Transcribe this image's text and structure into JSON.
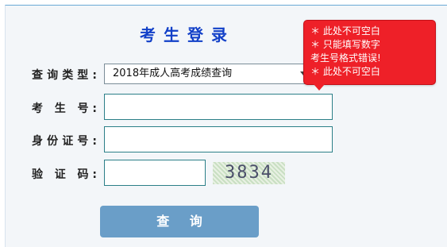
{
  "form": {
    "title": "考生登录",
    "labels": {
      "query_type": "查询类型:",
      "exam_number": "考 生 号:",
      "id_number": "身份证号:",
      "captcha": "验 证 码:"
    },
    "query_type_value": "2018年成人高考成绩查询",
    "captcha_text": "3834",
    "submit_label": "查 询"
  },
  "tooltip": {
    "lines": [
      "＊ 此处不可空白",
      "＊ 只能填写数字",
      "考生号格式错误!",
      "＊ 此处不可空白"
    ]
  },
  "colors": {
    "title": "#1240c8",
    "button": "#6a9ec8",
    "tooltip": "#ee2028"
  }
}
